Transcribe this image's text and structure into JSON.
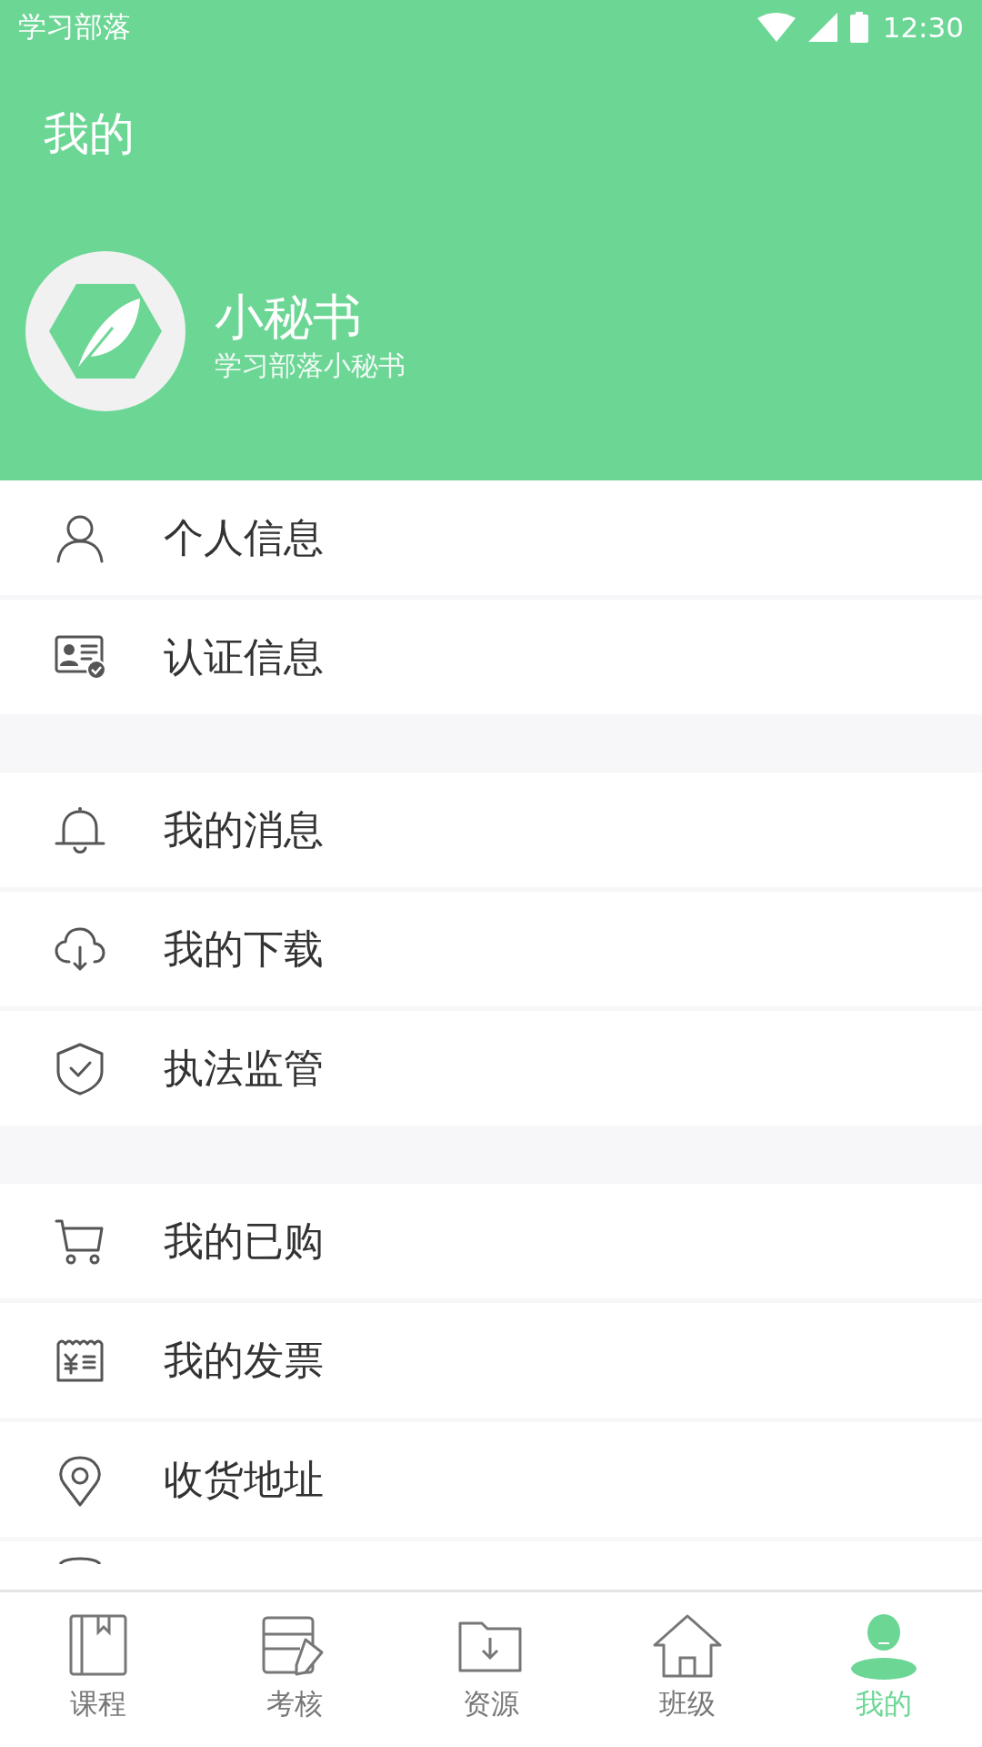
{
  "status_bar": {
    "app_name": "学习部落",
    "time": "12:30"
  },
  "header": {
    "title": "我的",
    "name": "小秘书",
    "subtitle": "学习部落小秘书"
  },
  "menu_groups": [
    [
      {
        "label": "个人信息"
      },
      {
        "label": "认证信息"
      }
    ],
    [
      {
        "label": "我的消息"
      },
      {
        "label": "我的下载"
      },
      {
        "label": "执法监管"
      }
    ],
    [
      {
        "label": "我的已购"
      },
      {
        "label": "我的发票"
      },
      {
        "label": "收货地址"
      }
    ]
  ],
  "tab_bar": [
    {
      "label": "课程",
      "selected": false
    },
    {
      "label": "考核",
      "selected": false
    },
    {
      "label": "资源",
      "selected": false
    },
    {
      "label": "班级",
      "selected": false
    },
    {
      "label": "我的",
      "selected": true
    }
  ]
}
